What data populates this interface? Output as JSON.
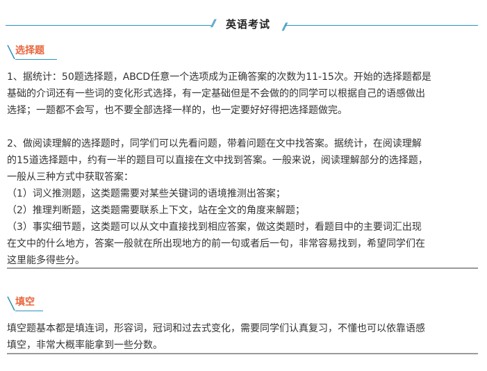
{
  "header": {
    "title": "英语考试"
  },
  "sections": [
    {
      "heading": "选择题",
      "para1": [
        "1、据统计：50题选择题，ABCD任意一个选项成为正确答案的次数为11-15次。开始的选择题都是",
        "基础的介词还有一些词的变化形式选择，有一定基础但是不会做的的同学可以根据自己的语感做出",
        "选择；一题都不会写，也不要全部选择一样的，也一定要好好得把选择题做完。"
      ],
      "para2": [
        "2、做阅读理解的选择题时，同学们可以先看问题，带着问题在文中找答案。据统计，在阅读理解",
        "的15道选择题中，约有一半的题目可以直接在文中找到答案。一般来说，阅读理解部分的选择题，",
        "一般从三种方式中获取答案：",
        "（1）词义推测题，这类题需要对某些关键词的语境推测出答案；",
        "（2）推理判断题，这类题需要联系上下文，站在全文的角度来解题；",
        "（3）事实细节题，这类题可以从文中直接找到相应答案，做这类题时，看题目中的主要词汇出现",
        "在文中的什么地方，答案一般就在所出现地方的前一句或者后一句，非常容易找到，希望同学们在",
        "这里能多得些分。"
      ]
    },
    {
      "heading": "填空",
      "para1": [
        "填空题基本都是填连词，形容词，冠词和过去式变化，需要同学们认真复习，不懂也可以依靠语感",
        "填空，非常大概率能拿到一些分数。"
      ]
    }
  ],
  "colors": {
    "accent": "#2a8fbd",
    "heading": "#e8663d",
    "text": "#333333",
    "rule": "#9a9a9a"
  }
}
